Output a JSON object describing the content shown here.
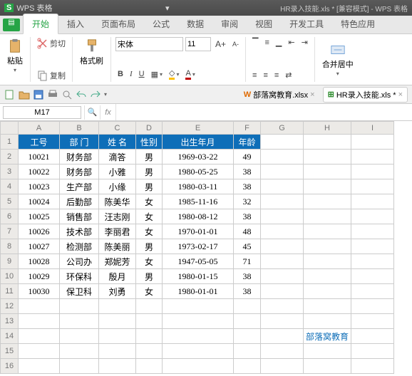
{
  "app": {
    "logo": "S",
    "name": "WPS 表格",
    "dropdown": "▾",
    "doctitle": "HR录入技能.xls * [兼容模式] - WPS 表格"
  },
  "menu": {
    "items": [
      "开始",
      "插入",
      "页面布局",
      "公式",
      "数据",
      "审阅",
      "视图",
      "开发工具",
      "特色应用"
    ]
  },
  "ribbon": {
    "paste": "粘贴",
    "cut": "剪切",
    "copy": "复制",
    "fmtpaint": "格式刷",
    "font": "宋体",
    "size": "11",
    "bold": "B",
    "italic": "I",
    "underline": "U",
    "aplus": "A+",
    "aminus": "A-",
    "merge": "合并居中"
  },
  "tabs": {
    "t1": "部落窝教育.xlsx",
    "t2": "HR录入技能.xls *",
    "close": "×"
  },
  "cellref": "M17",
  "fx": "fx",
  "cols": [
    "",
    "A",
    "B",
    "C",
    "D",
    "E",
    "F",
    "G",
    "H",
    "I"
  ],
  "widths": [
    25,
    58,
    55,
    52,
    37,
    100,
    38,
    60,
    60,
    60
  ],
  "headers": [
    "工号",
    "部 门",
    "姓 名",
    "性别",
    "出生年月",
    "年龄"
  ],
  "data": [
    [
      "10021",
      "财务部",
      "滴答",
      "男",
      "1969-03-22",
      "49"
    ],
    [
      "10022",
      "财务部",
      "小雅",
      "男",
      "1980-05-25",
      "38"
    ],
    [
      "10023",
      "生产部",
      "小缘",
      "男",
      "1980-03-11",
      "38"
    ],
    [
      "10024",
      "后勤部",
      "陈美华",
      "女",
      "1985-11-16",
      "32"
    ],
    [
      "10025",
      "销售部",
      "汪志刚",
      "女",
      "1980-08-12",
      "38"
    ],
    [
      "10026",
      "技术部",
      "李丽君",
      "女",
      "1970-01-01",
      "48"
    ],
    [
      "10027",
      "检测部",
      "陈美丽",
      "男",
      "1973-02-17",
      "45"
    ],
    [
      "10028",
      "公司办",
      "郑妮芳",
      "女",
      "1947-05-05",
      "71"
    ],
    [
      "10029",
      "环保科",
      "殷月",
      "男",
      "1980-01-15",
      "38"
    ],
    [
      "10030",
      "保卫科",
      "刘勇",
      "女",
      "1980-01-01",
      "38"
    ]
  ],
  "watermark": "部落窝教育"
}
